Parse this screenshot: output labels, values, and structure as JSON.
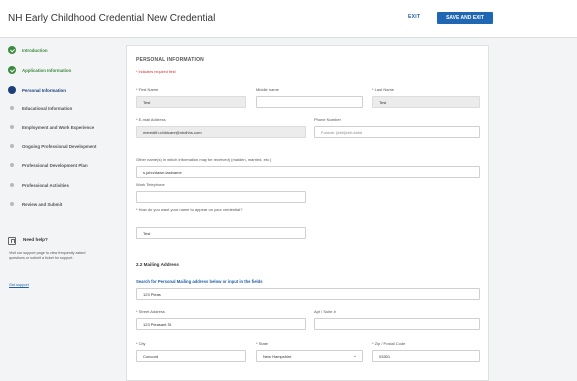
{
  "header": {
    "title": "NH Early Childhood Credential New Credential",
    "exit_label": "EXIT",
    "save_exit_label": "SAVE AND EXIT"
  },
  "sidebar": {
    "steps": [
      {
        "label": "Introduction",
        "status": "done"
      },
      {
        "label": "Application Information",
        "status": "done"
      },
      {
        "label": "Personal Information",
        "status": "current"
      },
      {
        "label": "Educational Information",
        "status": "pending"
      },
      {
        "label": "Employment and Work Experience",
        "status": "pending"
      },
      {
        "label": "Ongoing Professional Development",
        "status": "pending"
      },
      {
        "label": "Professional Development Plan",
        "status": "pending"
      },
      {
        "label": "Professional Activities",
        "status": "pending"
      },
      {
        "label": "Review and Submit",
        "status": "pending"
      }
    ],
    "help": {
      "title": "Need help?",
      "text": "Visit our support page to view frequently asked questions or submit a ticket for support.",
      "link": "Get support"
    }
  },
  "form": {
    "section_title": "PERSONAL INFORMATION",
    "required_note": "* Indicates required field",
    "first_name": {
      "label": "* First Name",
      "value": "Test"
    },
    "middle_name": {
      "label": "Middle name",
      "value": ""
    },
    "last_name": {
      "label": "* Last Name",
      "value": "Test"
    },
    "email": {
      "label": "* E-mail Address",
      "value": "meredith.childcare@nhdhhs.com"
    },
    "phone": {
      "label": "Phone Number",
      "placeholder": "Format: (###)###-####"
    },
    "other_names": {
      "label": "Other name(s) in which information may be received) (maiden, married, etc.)",
      "value": "s.john/dawn.lastname"
    },
    "work_phone": {
      "label": "Work Telephone",
      "value": ""
    },
    "credential_name": {
      "label": "* How do you want your name to appear on your credential?",
      "value": "Test"
    },
    "mailing": {
      "title": "2.2 Mailing Address",
      "search_label": "Search for Personal Mailing address below or input in the fields",
      "search_value": "123 Pleas",
      "street": {
        "label": "* Street Address",
        "value": "123 Pleasant St"
      },
      "apt": {
        "label": "Apt / Suite #",
        "value": ""
      },
      "city": {
        "label": "* City",
        "value": "Concord"
      },
      "state": {
        "label": "* State",
        "value": "New Hampshire"
      },
      "zip": {
        "label": "* Zip / Postal Code",
        "value": "03301"
      }
    }
  },
  "colors": {
    "accent": "#1f66b3",
    "done": "#3b8a3e",
    "current": "#1d3f78",
    "required": "#d12d2d"
  }
}
